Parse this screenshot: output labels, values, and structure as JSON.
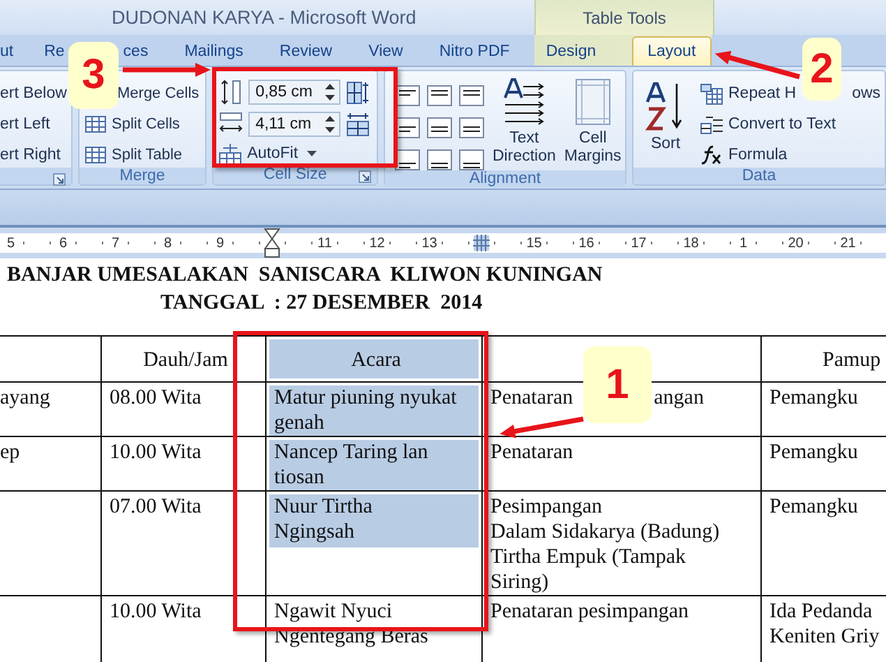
{
  "window": {
    "title": "DUDONAN KARYA - Microsoft Word",
    "context_group": "Table Tools"
  },
  "ribbon_tabs": [
    {
      "label": "ut",
      "selected": false
    },
    {
      "label_parts": [
        "Re",
        "ces"
      ],
      "selected": false
    },
    {
      "label": "Mailings",
      "selected": false
    },
    {
      "label": "Review",
      "selected": false
    },
    {
      "label": "View",
      "selected": false
    },
    {
      "label": "Nitro PDF",
      "selected": false
    },
    {
      "label": "Design",
      "selected": false
    },
    {
      "label": "Layout",
      "selected": true
    }
  ],
  "ribbon_groups": [
    {
      "kind": "rows-columns",
      "items": [
        "ert Below",
        "ert Left",
        "ert Right"
      ]
    },
    {
      "kind": "merge",
      "label": "Merge",
      "items": [
        "Merge Cells",
        "Split Cells",
        "Split Table"
      ]
    },
    {
      "kind": "cell-size",
      "label": "Cell Size",
      "height": "0,85 cm",
      "width": "4,11 cm",
      "autofit": "AutoFit"
    },
    {
      "kind": "alignment",
      "label": "Alignment",
      "buttons": [
        [
          "Text",
          "Direction"
        ],
        [
          "Cell",
          "Margins"
        ]
      ]
    },
    {
      "kind": "data",
      "label": "Data",
      "sort": "Sort",
      "items": [
        {
          "label_parts": [
            "Repeat H",
            "ows"
          ]
        },
        {
          "label": "Convert to Text"
        },
        {
          "label": "Formula"
        }
      ]
    }
  ],
  "ruler": [
    {
      "kind": "number",
      "label": "5"
    },
    {
      "kind": "number",
      "label": "6"
    },
    {
      "kind": "number",
      "label": "7"
    },
    {
      "kind": "number",
      "label": "8"
    },
    {
      "kind": "number",
      "label": "9"
    },
    {
      "kind": "indent-marker"
    },
    {
      "kind": "number",
      "label": "11"
    },
    {
      "kind": "number",
      "label": "12"
    },
    {
      "kind": "number",
      "label": "13"
    },
    {
      "kind": "column-marker"
    },
    {
      "kind": "number",
      "label": "15"
    },
    {
      "kind": "number",
      "label": "16"
    },
    {
      "kind": "number",
      "label": "17"
    },
    {
      "kind": "number",
      "label": "18"
    },
    {
      "kind": "number",
      "label": "1"
    },
    {
      "kind": "number",
      "label": "20"
    },
    {
      "kind": "number",
      "label": "21"
    }
  ],
  "document": {
    "heading": [
      "BANJAR UMESALAKAN  SANISCARA  KLIWON KUNINGAN",
      "TANGGAL  : 27 DESEMBER  2014"
    ],
    "table": {
      "header": [
        {
          "selected": false
        },
        {
          "lines": [
            "Dauh/Jam"
          ],
          "selected": false
        },
        {
          "lines": [
            "Acara"
          ],
          "selected": true
        },
        {
          "selected": false
        },
        {
          "lines": [
            "Pamup"
          ],
          "selected": false
        }
      ],
      "rows": [
        [
          {
            "lines": [
              "ayang"
            ],
            "selected": false
          },
          {
            "lines": [
              "08.00 Wita"
            ],
            "selected": false
          },
          {
            "lines": [
              "Matur piuning nyukat",
              "genah"
            ],
            "selected": true
          },
          {
            "parts": [
              "Penataran",
              "angan"
            ],
            "selected": false
          },
          {
            "lines": [
              "Pemangku"
            ],
            "selected": false
          }
        ],
        [
          {
            "lines": [
              "ep"
            ],
            "selected": false
          },
          {
            "lines": [
              "10.00 Wita"
            ],
            "selected": false
          },
          {
            "lines": [
              "Nancep Taring lan",
              "tiosan"
            ],
            "selected": true
          },
          {
            "lines": [
              "Penataran"
            ],
            "selected": false
          },
          {
            "lines": [
              "Pemangku"
            ],
            "selected": false
          }
        ],
        [
          {
            "selected": false
          },
          {
            "lines": [
              "07.00 Wita"
            ],
            "selected": false
          },
          {
            "lines": [
              "Nuur Tirtha",
              "Ngingsah"
            ],
            "selected": true
          },
          {
            "lines": [
              "Pesimpangan",
              "Dalam Sidakarya (Badung)",
              "Tirtha Empuk (Tampak",
              "Siring)"
            ],
            "selected": false
          },
          {
            "lines": [
              "Pemangku"
            ],
            "selected": false
          }
        ],
        [
          {
            "selected": false
          },
          {
            "lines": [
              "10.00 Wita"
            ],
            "selected": false
          },
          {
            "lines": [
              "Ngawit Nyuci",
              "Ngentegang Beras"
            ],
            "selected": false
          },
          {
            "lines": [
              "Penataran pesimpangan"
            ],
            "selected": false
          },
          {
            "lines": [
              "Ida Pedanda",
              "Keniten Griy"
            ],
            "selected": false
          }
        ]
      ]
    }
  },
  "annotations": [
    {
      "label": "1"
    },
    {
      "label": "2"
    },
    {
      "label": "3"
    }
  ]
}
